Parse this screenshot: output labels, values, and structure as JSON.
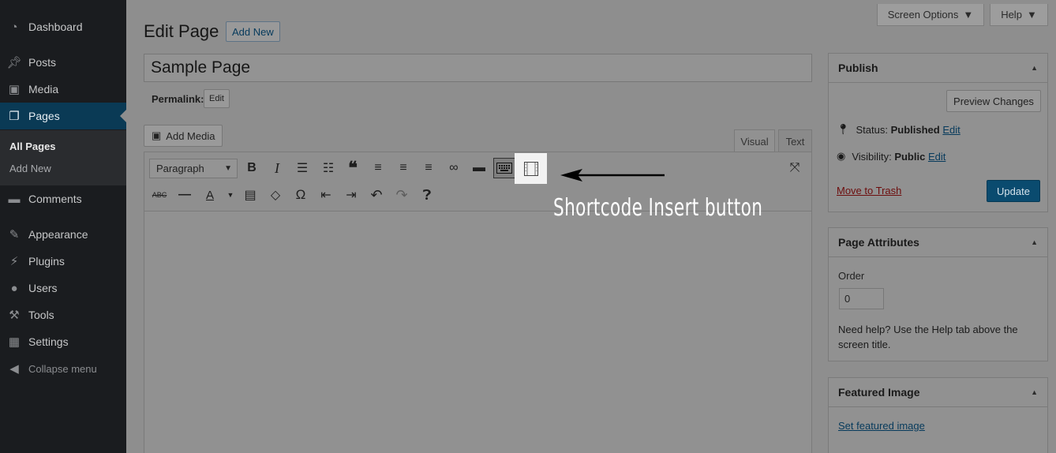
{
  "sidebar": {
    "items": [
      {
        "label": "Dashboard",
        "icon": "dashboard-icon"
      },
      {
        "label": "Posts",
        "icon": "pin-icon"
      },
      {
        "label": "Media",
        "icon": "media-icon"
      },
      {
        "label": "Pages",
        "icon": "pages-icon"
      },
      {
        "label": "Comments",
        "icon": "comment-icon"
      },
      {
        "label": "Appearance",
        "icon": "brush-icon"
      },
      {
        "label": "Plugins",
        "icon": "plugin-icon"
      },
      {
        "label": "Users",
        "icon": "user-icon"
      },
      {
        "label": "Tools",
        "icon": "wrench-icon"
      },
      {
        "label": "Settings",
        "icon": "settings-icon"
      }
    ],
    "submenu": [
      "All Pages",
      "Add New"
    ],
    "collapse": "Collapse menu"
  },
  "top": {
    "screen_options": "Screen Options",
    "help": "Help"
  },
  "heading": {
    "title": "Edit Page",
    "add_new": "Add New"
  },
  "post": {
    "title": "Sample Page",
    "permalink_label": "Permalink:",
    "permalink_edit": "Edit"
  },
  "editor": {
    "add_media": "Add Media",
    "tab_visual": "Visual",
    "tab_text": "Text",
    "format": "Paragraph",
    "annotation": "Shortcode Insert button"
  },
  "publish": {
    "title": "Publish",
    "preview": "Preview Changes",
    "status_label": "Status:",
    "status_value": "Published",
    "visibility_label": "Visibility:",
    "visibility_value": "Public",
    "edit": "Edit",
    "trash": "Move to Trash",
    "update": "Update"
  },
  "attributes": {
    "title": "Page Attributes",
    "order_label": "Order",
    "order_value": "0",
    "help_line1": "Need help? Use the Help tab above the",
    "help_line2": "screen title."
  },
  "featured": {
    "title": "Featured Image",
    "link": "Set featured image"
  }
}
